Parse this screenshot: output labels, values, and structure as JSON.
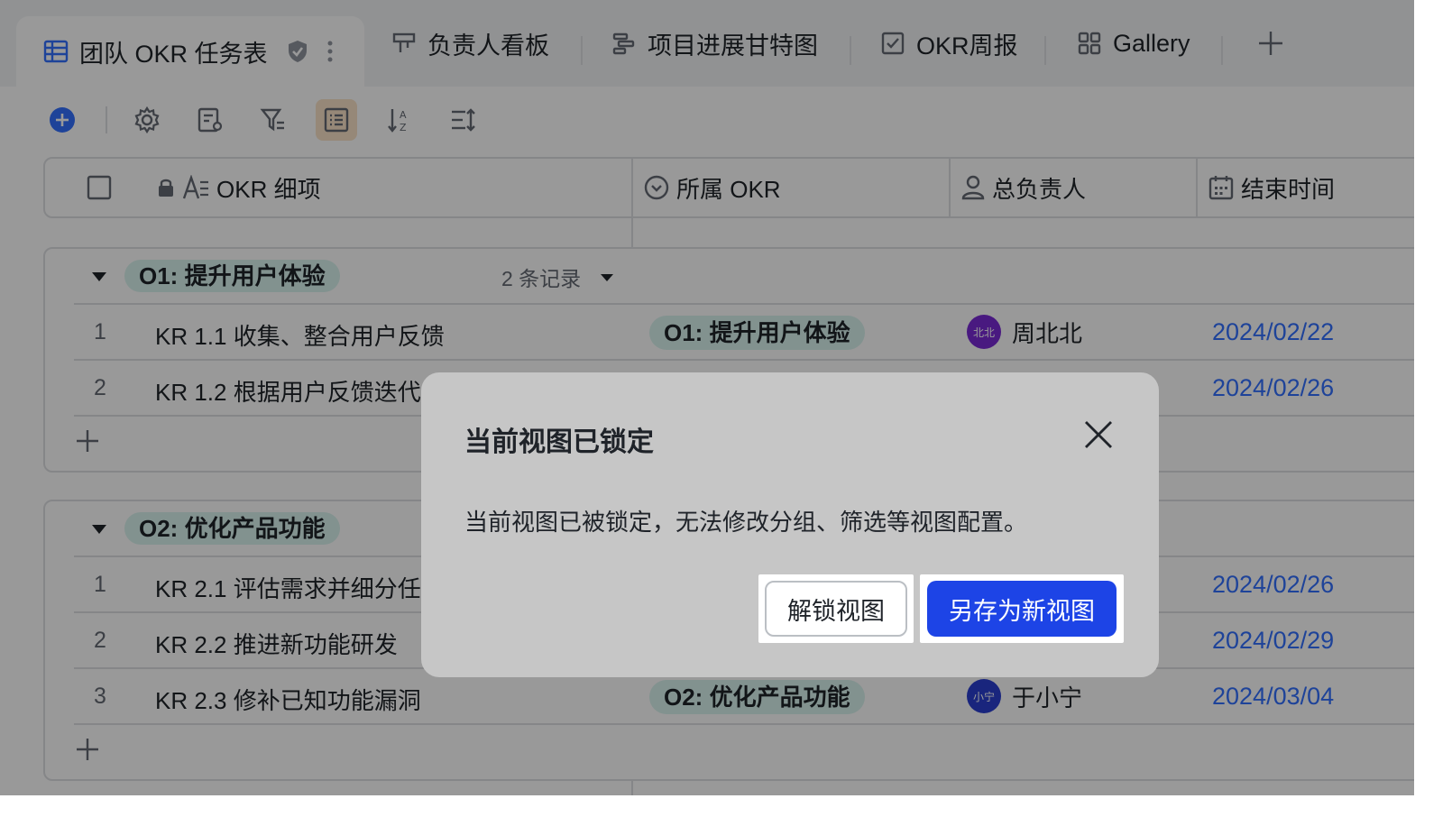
{
  "tabs": [
    {
      "label": "团队 OKR 任务表",
      "icon": "grid-table-icon",
      "active": true
    },
    {
      "label": "负责人看板",
      "icon": "kanban-icon"
    },
    {
      "label": "项目进展甘特图",
      "icon": "gantt-icon"
    },
    {
      "label": "OKR周报",
      "icon": "form-icon"
    },
    {
      "label": "Gallery",
      "icon": "gallery-icon"
    }
  ],
  "columns": {
    "okr_item": "OKR 细项",
    "okr": "所属 OKR",
    "owner": "总负责人",
    "end_time": "结束时间"
  },
  "groups": [
    {
      "title": "O1: 提升用户体验",
      "count": "2 条记录",
      "rows": [
        {
          "index": "1",
          "name": "KR 1.1 收集、整合用户反馈",
          "okr": "O1: 提升用户体验",
          "owner": "周北北",
          "avatar": "北北",
          "date": "2024/02/22"
        },
        {
          "index": "2",
          "name": "KR 1.2 根据用户反馈迭代",
          "okr": "",
          "owner": "",
          "avatar": "",
          "date": "2024/02/26"
        }
      ]
    },
    {
      "title": "O2: 优化产品功能",
      "count": "",
      "rows": [
        {
          "index": "1",
          "name": "KR 2.1 评估需求并细分任",
          "okr": "",
          "owner": "",
          "avatar": "",
          "date": "2024/02/26"
        },
        {
          "index": "2",
          "name": "KR 2.2 推进新功能研发",
          "okr": "",
          "owner": "",
          "avatar": "",
          "date": "2024/02/29"
        },
        {
          "index": "3",
          "name": "KR 2.3 修补已知功能漏洞",
          "okr": "O2: 优化产品功能",
          "owner": "于小宁",
          "avatar": "小宁",
          "date": "2024/03/04"
        }
      ]
    }
  ],
  "modal": {
    "title": "当前视图已锁定",
    "message": "当前视图已被锁定，无法修改分组、筛选等视图配置。",
    "unlock_label": "解锁视图",
    "save_as_label": "另存为新视图"
  },
  "colors": {
    "accent": "#3370ff",
    "primary_button": "#1d44e6",
    "tag_bg": "#d9f3ef",
    "avatar_purple": "#7a2bd6",
    "avatar_blue": "#2a3fd1"
  }
}
